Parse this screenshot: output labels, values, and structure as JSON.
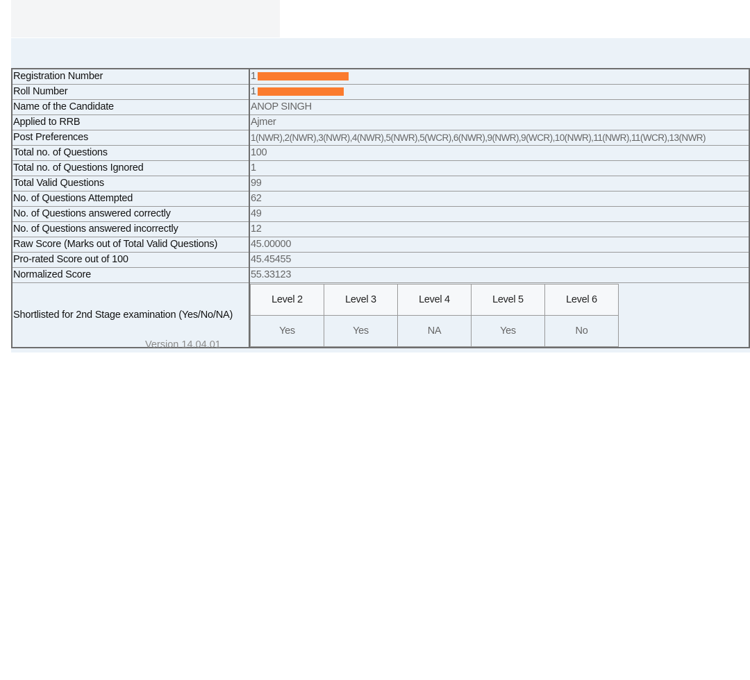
{
  "rows": [
    {
      "label": "Registration Number",
      "value": "1",
      "redacted": true
    },
    {
      "label": "Roll Number",
      "value": "1",
      "redacted": true
    },
    {
      "label": "Name of the Candidate",
      "value": "ANOP SINGH"
    },
    {
      "label": "Applied to RRB",
      "value": "Ajmer"
    },
    {
      "label": "Post Preferences",
      "value": "1(NWR),2(NWR),3(NWR),4(NWR),5(NWR),5(WCR),6(NWR),9(NWR),9(WCR),10(NWR),11(NWR),11(WCR),13(NWR)"
    },
    {
      "label": "Total no. of Questions",
      "value": "100"
    },
    {
      "label": "Total no. of Questions Ignored",
      "value": "1"
    },
    {
      "label": "Total Valid Questions",
      "value": "99"
    },
    {
      "label": "No. of Questions Attempted",
      "value": "62"
    },
    {
      "label": "No. of Questions answered correctly",
      "value": "49"
    },
    {
      "label": "No. of Questions answered incorrectly",
      "value": "12"
    },
    {
      "label": "Raw Score (Marks out of Total Valid Questions)",
      "value": "45.00000"
    },
    {
      "label": "Pro-rated Score out of 100",
      "value": "45.45455"
    },
    {
      "label": "Normalized Score",
      "value": "55.33123"
    }
  ],
  "shortlist": {
    "label": "Shortlisted for 2nd Stage examination (Yes/No/NA)",
    "levels": [
      {
        "name": "Level 2",
        "status": "Yes"
      },
      {
        "name": "Level 3",
        "status": "Yes"
      },
      {
        "name": "Level 4",
        "status": "NA"
      },
      {
        "name": "Level 5",
        "status": "Yes"
      },
      {
        "name": "Level 6",
        "status": "No"
      }
    ]
  },
  "version": "Version 14.04.01",
  "colors": {
    "redaction": "#fb7b2e",
    "panel_background": "#ebf2f8"
  }
}
